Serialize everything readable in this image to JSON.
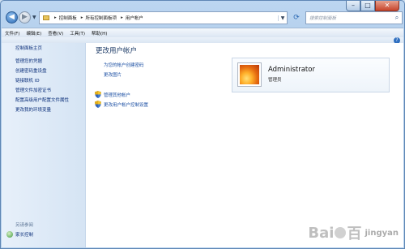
{
  "window": {
    "caption_buttons": [
      "–",
      "□",
      "✕"
    ]
  },
  "address": {
    "crumbs": [
      "控制面板",
      "所有控制面板项",
      "用户帐户"
    ],
    "search_placeholder": "搜索控制面板"
  },
  "menu": [
    "文件(F)",
    "编辑(E)",
    "查看(V)",
    "工具(T)",
    "帮助(H)"
  ],
  "sidebar": {
    "home": "控制面板主页",
    "links": [
      "管理您的凭据",
      "创建密码重设盘",
      "链接联机 ID",
      "管理文件加密证书",
      "配置高级用户配置文件属性",
      "更改我的环境变量"
    ],
    "see_also_heading": "另请参阅",
    "parental_controls": "家长控制"
  },
  "main": {
    "title": "更改用户帐户",
    "links": [
      "为您的帐户创建密码",
      "更改图片"
    ],
    "shield_links": [
      "管理其他帐户",
      "更改用户帐户控制设置"
    ]
  },
  "account": {
    "name": "Administrator",
    "role": "管理员"
  },
  "watermark": {
    "text_left": "Bai",
    "text_right": "百",
    "sub": "jingyan"
  },
  "colors": {
    "link": "#1b4fa3",
    "title": "#1e3c68",
    "sidebar_bg": "#e7f0fa"
  }
}
